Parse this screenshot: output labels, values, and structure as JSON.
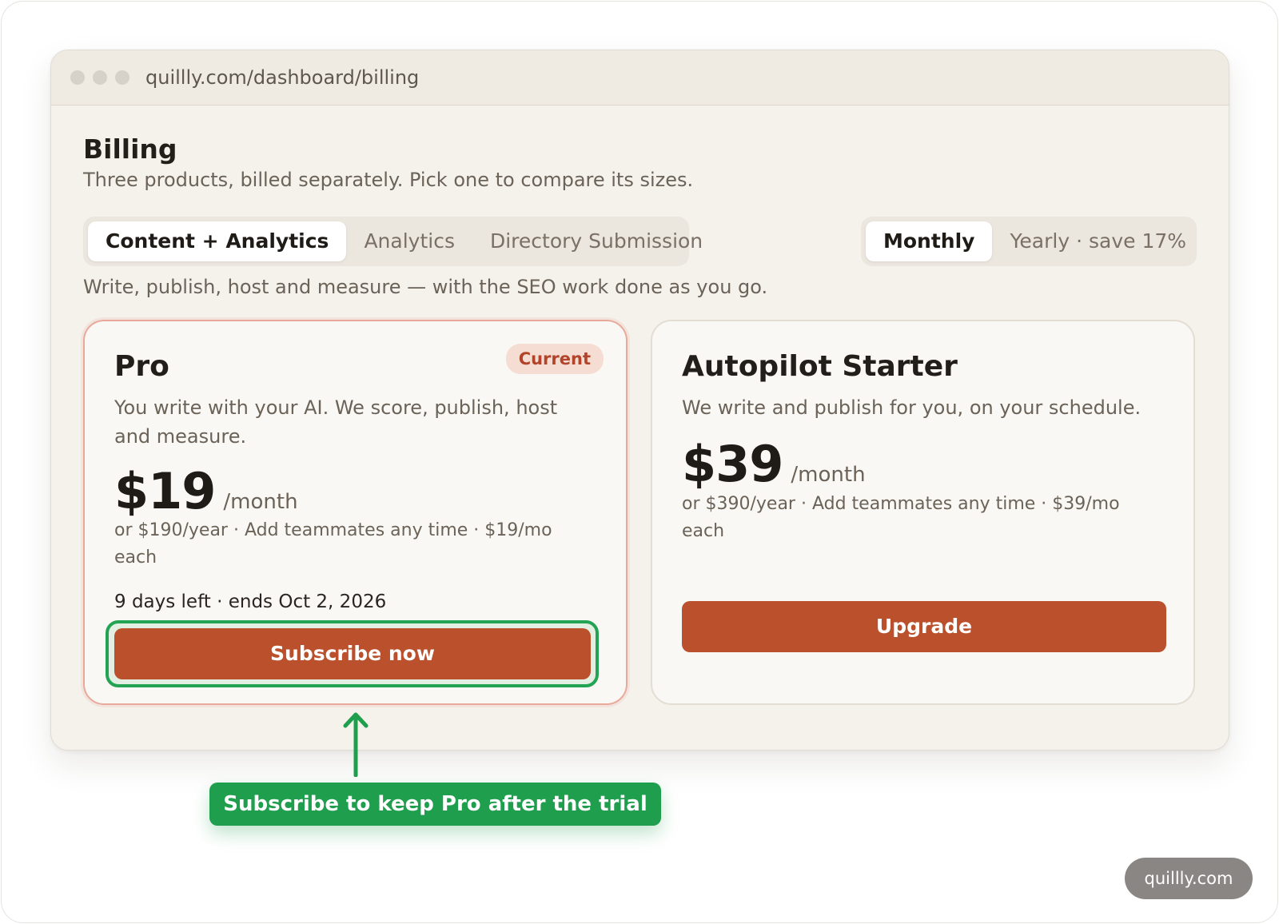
{
  "browser": {
    "url": "quillly.com/dashboard/billing"
  },
  "page": {
    "title": "Billing",
    "subtitle": "Three products, billed separately. Pick one to compare its sizes."
  },
  "product_tabs": [
    {
      "label": "Content + Analytics",
      "active": true
    },
    {
      "label": "Analytics",
      "active": false
    },
    {
      "label": "Directory Submission",
      "active": false
    }
  ],
  "billing_period": [
    {
      "label": "Monthly",
      "active": true
    },
    {
      "label": "Yearly · save 17%",
      "active": false
    }
  ],
  "product_description": "Write, publish, host and measure — with the SEO work done as you go.",
  "plans": {
    "pro": {
      "name": "Pro",
      "badge": "Current",
      "description": "You write with your AI. We score, publish, host and measure.",
      "price": "$19",
      "per": "/month",
      "note": "or $190/year · Add teammates any time · $19/mo each",
      "trial": "9 days left · ends Oct 2, 2026",
      "button": "Subscribe now"
    },
    "autopilot": {
      "name": "Autopilot Starter",
      "description": "We write and publish for you, on your schedule.",
      "price": "$39",
      "per": "/month",
      "note": "or $390/year · Add teammates any time · $39/mo each",
      "button": "Upgrade"
    }
  },
  "callout": "Subscribe to keep Pro after the trial",
  "watermark": "quillly.com",
  "colors": {
    "accent": "#ba502c",
    "highlight": "#23a354",
    "badge_bg": "#f6ddd3",
    "badge_text": "#b1442a"
  }
}
